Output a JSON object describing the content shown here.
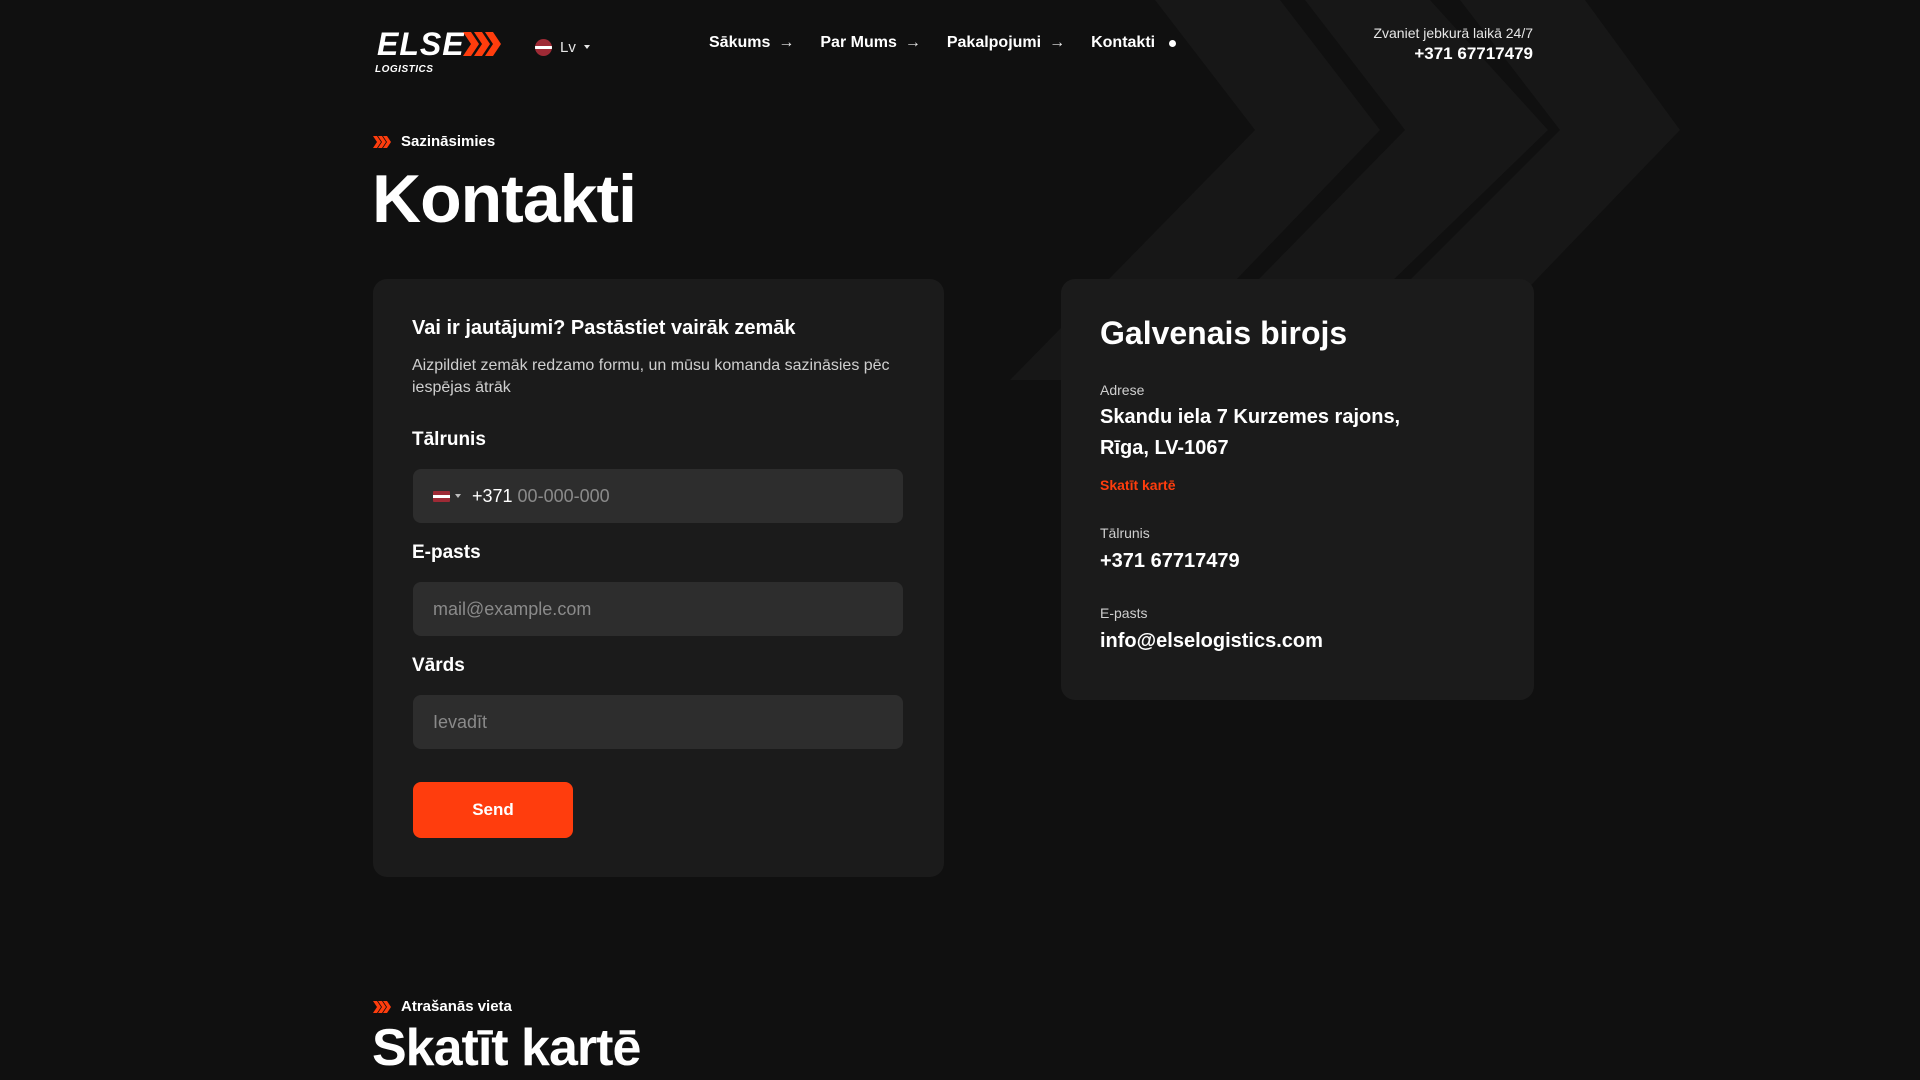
{
  "header": {
    "logo_word": "ELSE",
    "logo_sub": "LOGISTICS",
    "language": "Lv",
    "nav": [
      {
        "label": "Sākums",
        "icon": "arrow-right-icon"
      },
      {
        "label": "Par Mums",
        "icon": "arrow-right-icon"
      },
      {
        "label": "Pakalpojumi",
        "icon": "arrow-right-icon"
      },
      {
        "label": "Kontakti",
        "icon": "active-dot-icon"
      }
    ],
    "call_text": "Zvaniet jebkurā laikā 24/7",
    "call_phone": "+371 67717479"
  },
  "hero": {
    "eyebrow": "Sazināsimies",
    "title": "Kontakti"
  },
  "form": {
    "heading": "Vai ir jautājumi? Pastāstiet vairāk zemāk",
    "subtitle": "Aizpildiet zemāk redzamo formu, un mūsu komanda sazināsies pēc iespējas ātrāk",
    "phone_label": "Tālrunis",
    "phone_code": "+371",
    "phone_placeholder": "00-000-000",
    "email_label": "E-pasts",
    "email_placeholder": "mail@example.com",
    "name_label": "Vārds",
    "name_placeholder": "Ievadīt",
    "submit_label": "Send"
  },
  "office": {
    "title": "Galvenais birojs",
    "address_label": "Adrese",
    "address_line1": "Skandu iela 7 Kurzemes rajons,",
    "address_line2": "Rīga, LV-1067",
    "map_link": "Skatīt kartē",
    "phone_label": "Tālrunis",
    "phone_value": "+371 67717479",
    "email_label": "E-pasts",
    "email_value": "info@elselogistics.com"
  },
  "location": {
    "eyebrow": "Atrašanās vieta",
    "title": "Skatīt kartē"
  },
  "colors": {
    "background": "#101010",
    "card": "#1b1b1b",
    "input": "#2d2d2d",
    "accent": "#ff3d0d"
  }
}
